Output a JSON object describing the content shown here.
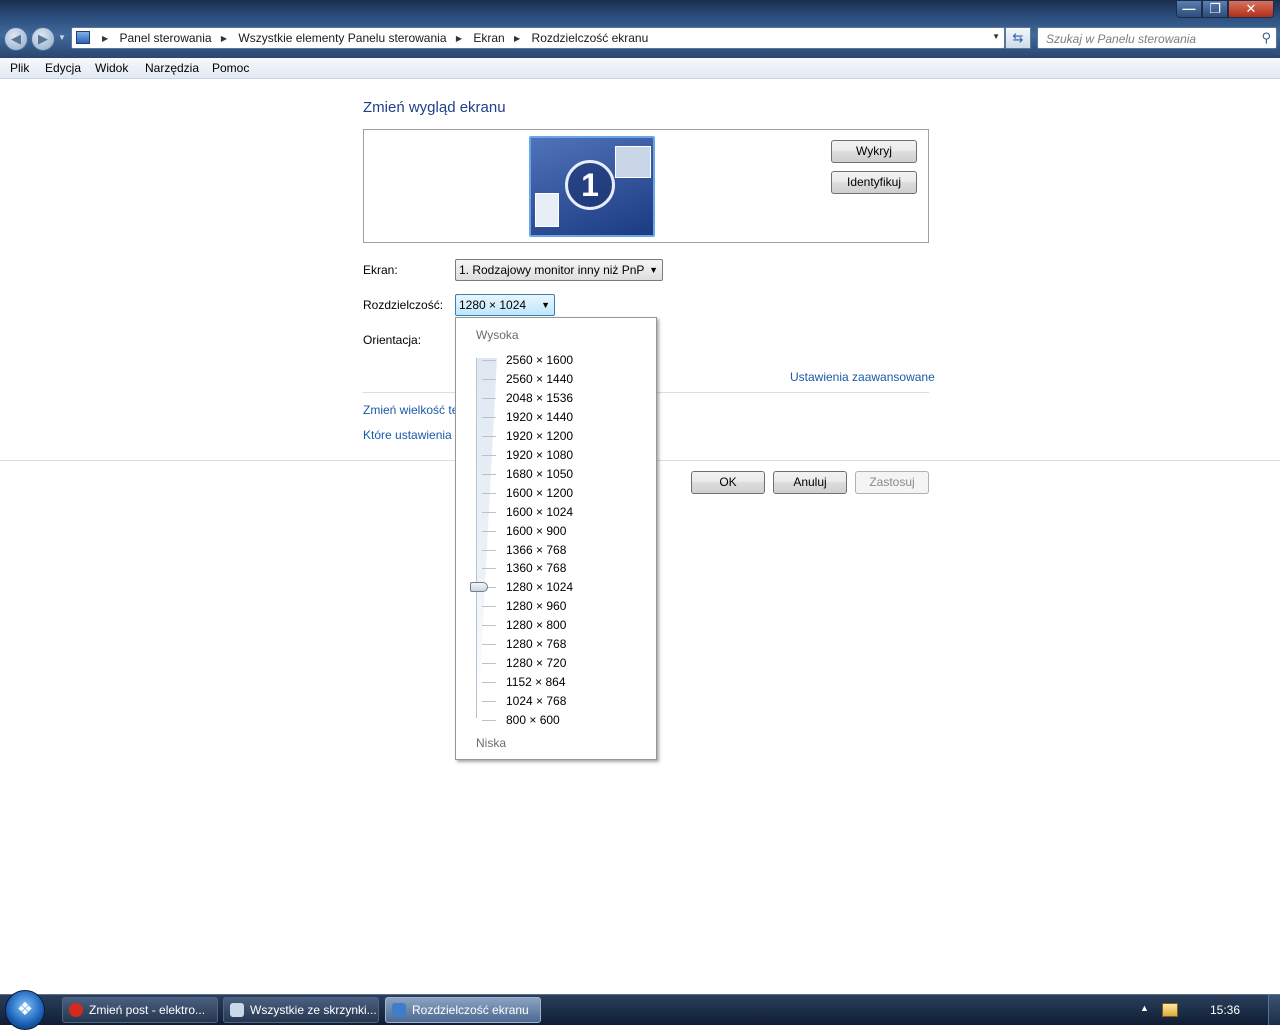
{
  "window": {
    "min_symbol": "—",
    "max_symbol": "❐",
    "close_symbol": "✕"
  },
  "address_bar": {
    "crumbs": [
      "Panel sterowania",
      "Wszystkie elementy Panelu sterowania",
      "Ekran",
      "Rozdzielczość ekranu"
    ],
    "icon": "control-panel-icon"
  },
  "search": {
    "placeholder": "Szukaj w Panelu sterowania",
    "icon": "search-icon"
  },
  "menu": {
    "items": [
      "Plik",
      "Edycja",
      "Widok",
      "Narzędzia",
      "Pomoc"
    ]
  },
  "page": {
    "title": "Zmień wygląd ekranu",
    "monitor_number": "1",
    "detect_label": "Wykryj",
    "identify_label": "Identyfikuj",
    "screen_label": "Ekran:",
    "screen_value": "1. Rodzajowy monitor inny niż PnP",
    "resolution_label": "Rozdzielczość:",
    "resolution_value": "1280 × 1024",
    "orientation_label": "Orientacja:",
    "advanced_link": "Ustawienia zaawansowane",
    "link_text_size": "Zmień wielkość te",
    "link_which_settings": "Które ustawienia v",
    "ok_label": "OK",
    "cancel_label": "Anuluj",
    "apply_label": "Zastosuj"
  },
  "resolution_dropdown": {
    "high_label": "Wysoka",
    "low_label": "Niska",
    "options": [
      "2560 × 1600",
      "2560 × 1440",
      "2048 × 1536",
      "1920 × 1440",
      "1920 × 1200",
      "1920 × 1080",
      "1680 × 1050",
      "1600 × 1200",
      "1600 × 1024",
      "1600 × 900",
      "1366 × 768",
      "1360 × 768",
      "1280 × 1024",
      "1280 × 960",
      "1280 × 800",
      "1280 × 768",
      "1280 × 720",
      "1152 × 864",
      "1024 × 768",
      "800 × 600"
    ],
    "selected_index": 12
  },
  "taskbar": {
    "tasks": [
      {
        "label": "Zmień post - elektro...",
        "icon": "opera-icon",
        "color": "#d42a1e"
      },
      {
        "label": "Wszystkie ze skrzynki...",
        "icon": "mail-icon",
        "color": "#c9d7e8"
      },
      {
        "label": "Rozdzielczość ekranu",
        "icon": "display-icon",
        "color": "#3f7cc9"
      }
    ],
    "clock": "15:36"
  }
}
